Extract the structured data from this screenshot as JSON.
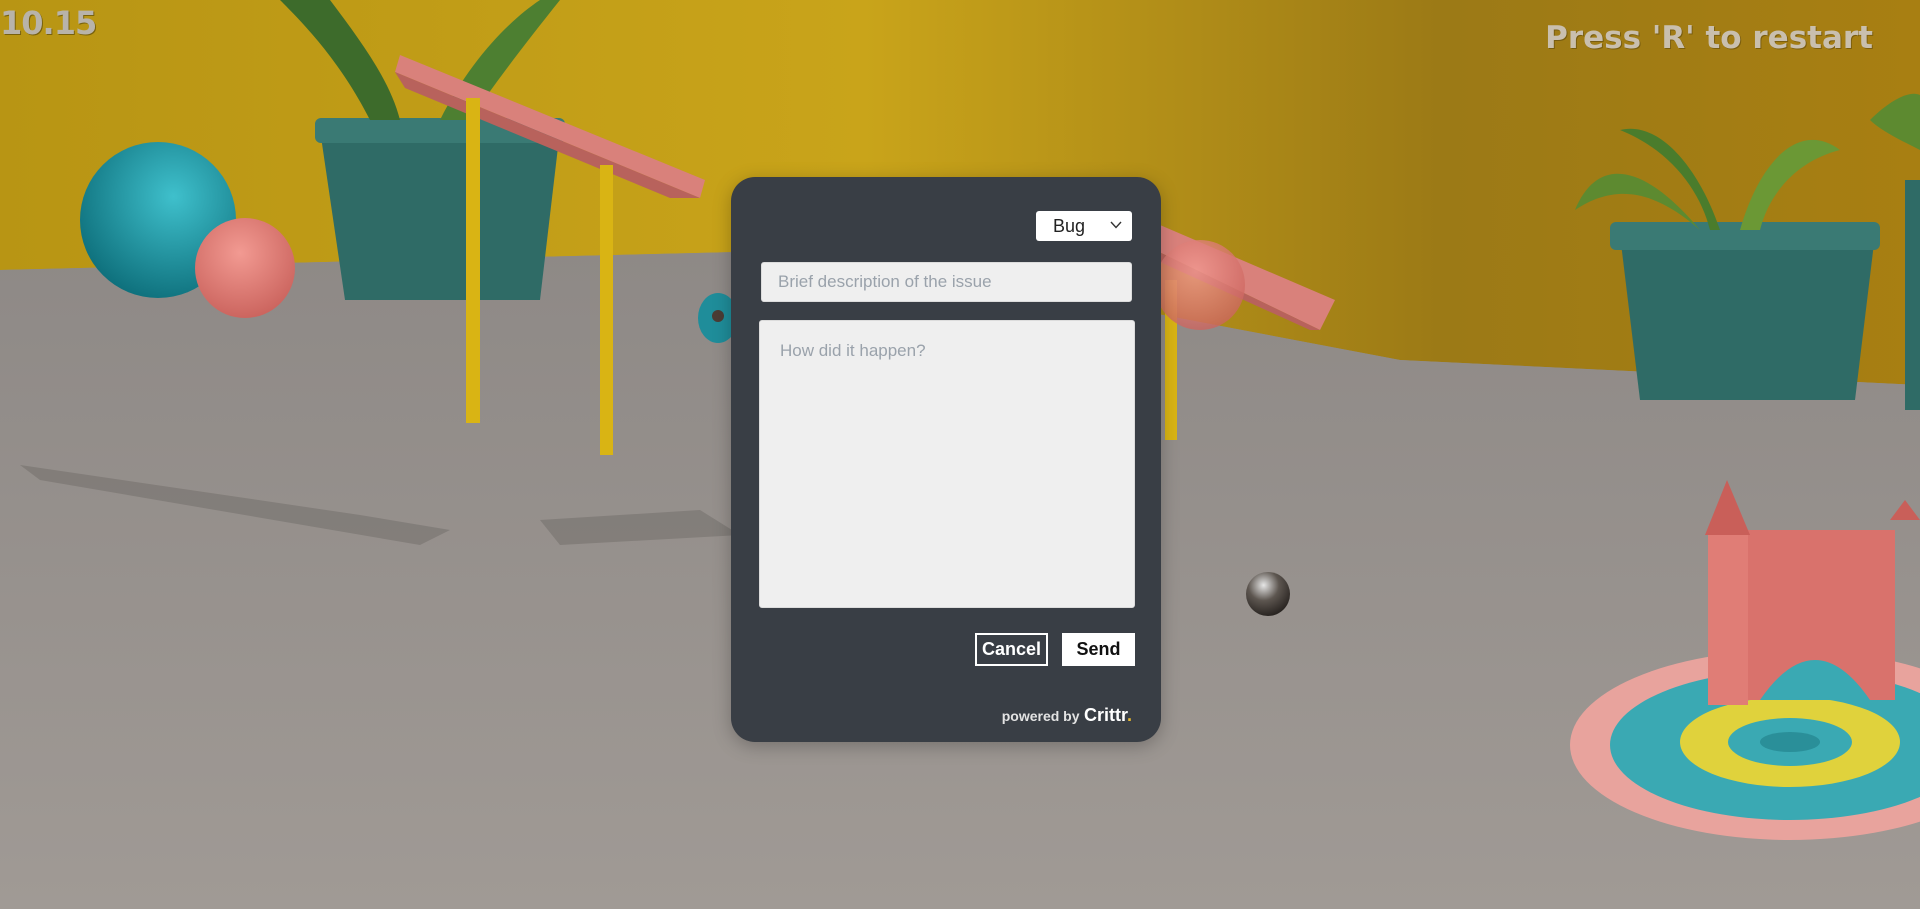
{
  "hud": {
    "timer": "10.15",
    "restart_hint": "Press 'R' to restart"
  },
  "dialog": {
    "type_select": {
      "selected": "Bug",
      "icon": "chevron-down-icon"
    },
    "summary_placeholder": "Brief description of the issue",
    "summary_value": "",
    "details_placeholder": "How did it happen?",
    "details_value": "",
    "cancel_label": "Cancel",
    "send_label": "Send",
    "powered_by": "powered by",
    "brand": "Crittr",
    "brand_dot": "."
  },
  "colors": {
    "dialog_bg": "#393e45",
    "wall": "#c9a21a",
    "floor": "#8f8a85",
    "accent_dot": "#e5b72f"
  }
}
